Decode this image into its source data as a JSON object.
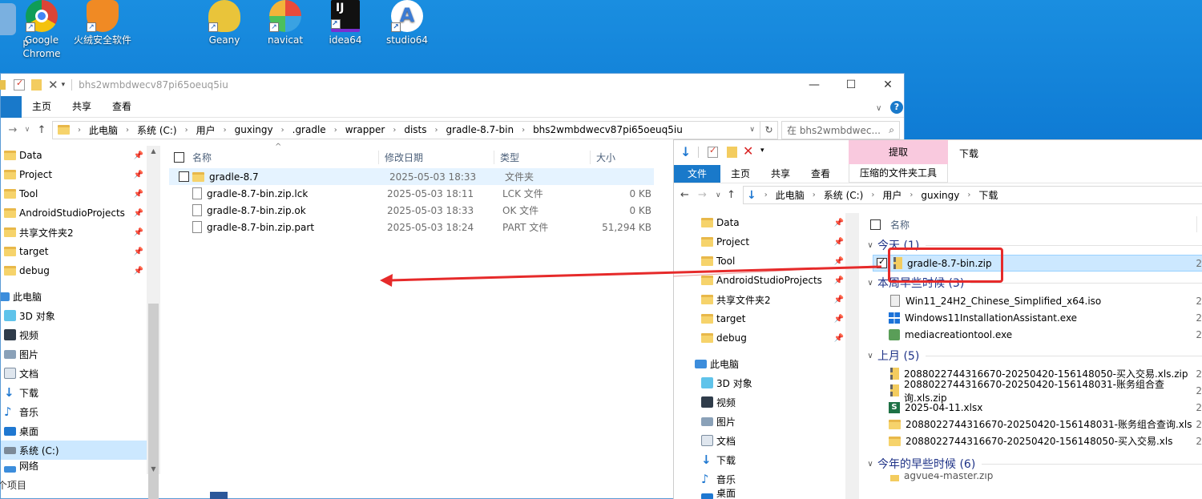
{
  "desktop": {
    "icons": [
      {
        "label": "p"
      },
      {
        "label": "Google\nChrome"
      },
      {
        "label": "火绒安全软件"
      },
      {
        "label": "Geany"
      },
      {
        "label": "navicat"
      },
      {
        "label": "idea64"
      },
      {
        "label": "studio64"
      }
    ]
  },
  "win1": {
    "title": "bhs2wmbdwecv87pi65oeuq5iu",
    "tabs": [
      "主页",
      "共享",
      "查看"
    ],
    "path": [
      "此电脑",
      "系统 (C:)",
      "用户",
      "guxingy",
      ".gradle",
      "wrapper",
      "dists",
      "gradle-8.7-bin",
      "bhs2wmbdwecv87pi65oeuq5iu"
    ],
    "search_placeholder": "在 bhs2wmbdwec...",
    "nav": {
      "quick": [
        {
          "label": "Data"
        },
        {
          "label": "Project"
        },
        {
          "label": "Tool"
        },
        {
          "label": "AndroidStudioProjects"
        },
        {
          "label": "共享文件夹2"
        },
        {
          "label": "target"
        },
        {
          "label": "debug"
        }
      ],
      "pc_label": "此电脑",
      "pc": [
        {
          "label": "3D 对象"
        },
        {
          "label": "视频"
        },
        {
          "label": "图片"
        },
        {
          "label": "文档"
        },
        {
          "label": "下载"
        },
        {
          "label": "音乐"
        },
        {
          "label": "桌面"
        },
        {
          "label": "系统 (C:)"
        }
      ],
      "network": "网络"
    },
    "columns": {
      "name": "名称",
      "date": "修改日期",
      "type": "类型",
      "size": "大小"
    },
    "files": [
      {
        "name": "gradle-8.7",
        "date": "2025-05-03 18:33",
        "type": "文件夹",
        "size": ""
      },
      {
        "name": "gradle-8.7-bin.zip.lck",
        "date": "2025-05-03 18:11",
        "type": "LCK 文件",
        "size": "0 KB"
      },
      {
        "name": "gradle-8.7-bin.zip.ok",
        "date": "2025-05-03 18:33",
        "type": "OK 文件",
        "size": "0 KB"
      },
      {
        "name": "gradle-8.7-bin.zip.part",
        "date": "2025-05-03 18:24",
        "type": "PART 文件",
        "size": "51,294 KB"
      }
    ],
    "status": "个项目"
  },
  "win2": {
    "ctx_tab": "提取",
    "ctx_group": "压缩的文件夹工具",
    "download_label": "下载",
    "tabs": {
      "file": "文件",
      "home": "主页",
      "share": "共享",
      "view": "查看"
    },
    "path": [
      "此电脑",
      "系统 (C:)",
      "用户",
      "guxingy",
      "下载"
    ],
    "nav": {
      "quick": [
        {
          "label": "Data"
        },
        {
          "label": "Project"
        },
        {
          "label": "Tool"
        },
        {
          "label": "AndroidStudioProjects"
        },
        {
          "label": "共享文件夹2"
        },
        {
          "label": "target"
        },
        {
          "label": "debug"
        }
      ],
      "pc_label": "此电脑",
      "pc": [
        {
          "label": "3D 对象"
        },
        {
          "label": "视频"
        },
        {
          "label": "图片"
        },
        {
          "label": "文档"
        },
        {
          "label": "下载"
        },
        {
          "label": "音乐"
        },
        {
          "label": "桌面"
        }
      ]
    },
    "col_name": "名称",
    "groups": [
      {
        "title": "今天 (1)",
        "items": [
          {
            "name": "gradle-8.7-bin.zip",
            "icon": "zip-icon"
          }
        ]
      },
      {
        "title": "本周早些时候 (3)",
        "items": [
          {
            "name": "Win11_24H2_Chinese_Simplified_x64.iso",
            "icon": "iso-icon"
          },
          {
            "name": "Windows11InstallationAssistant.exe",
            "icon": "windows-logo-icon"
          },
          {
            "name": "mediacreationtool.exe",
            "icon": "exe-icon"
          }
        ]
      },
      {
        "title": "上月 (5)",
        "items": [
          {
            "name": "2088022744316670-20250420-156148050-买入交易.xls.zip",
            "icon": "zip-icon"
          },
          {
            "name": "2088022744316670-20250420-156148031-账务组合查询.xls.zip",
            "icon": "zip-icon"
          },
          {
            "name": "2025-04-11.xlsx",
            "icon": "excel-icon"
          },
          {
            "name": "2088022744316670-20250420-156148031-账务组合查询.xls",
            "icon": "folder-icon"
          },
          {
            "name": "2088022744316670-20250420-156148050-买入交易.xls",
            "icon": "folder-icon"
          }
        ]
      },
      {
        "title": "今年的早些时候 (6)",
        "items": [
          {
            "name": "agvue4-master.zip",
            "icon": "zip-icon"
          }
        ]
      }
    ],
    "date_trunc": "2"
  }
}
